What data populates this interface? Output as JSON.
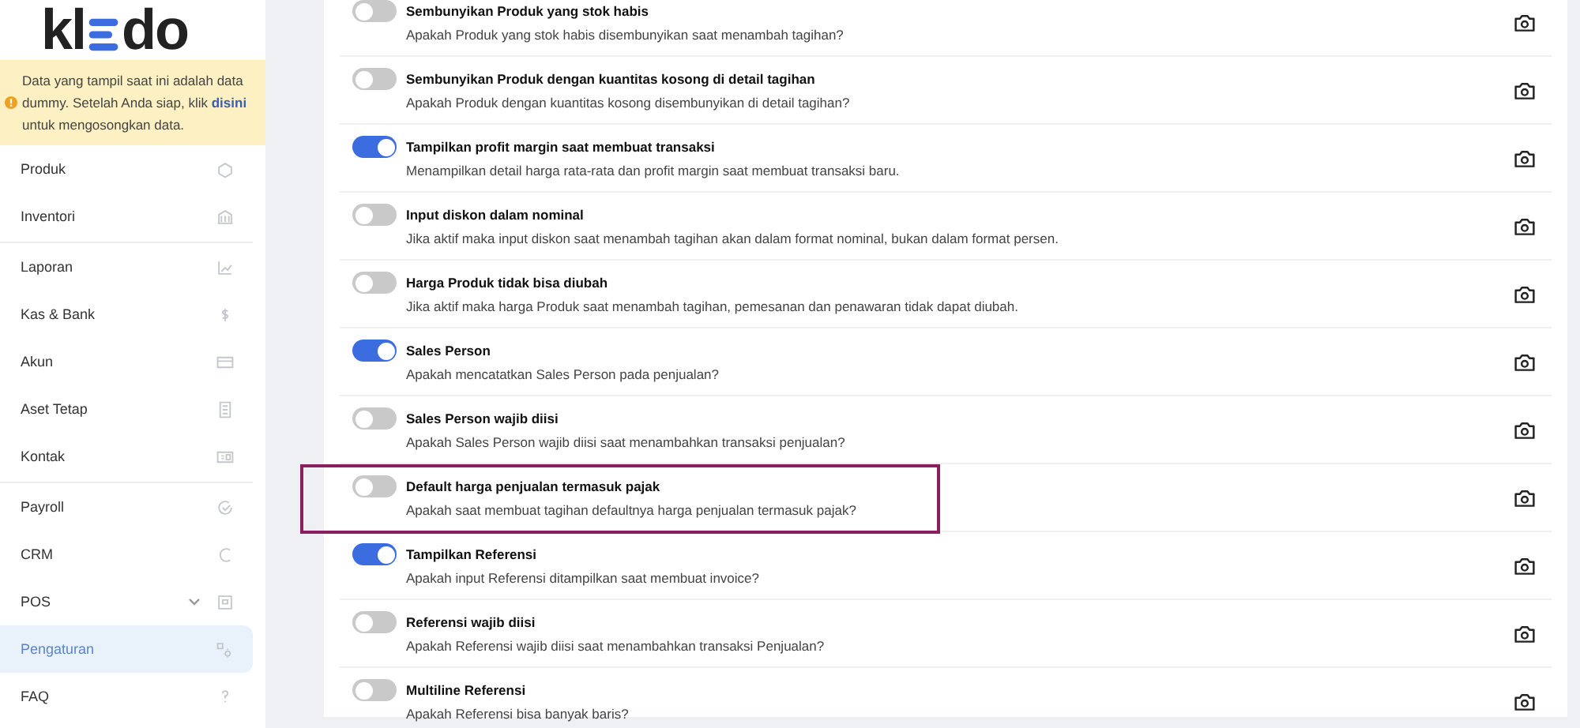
{
  "sidebar": {
    "logo": {
      "left": "kl",
      "right": "do"
    },
    "notice": {
      "before": "Data yang tampil saat ini adalah data dummy. Setelah Anda siap, klik ",
      "link": "disini",
      "after": " untuk mengosongkan data."
    },
    "groups": [
      [
        {
          "label": "Produk",
          "selected": false,
          "expandable": false
        },
        {
          "label": "Inventori",
          "selected": false,
          "expandable": false
        }
      ],
      [
        {
          "label": "Laporan",
          "selected": false,
          "expandable": false
        },
        {
          "label": "Kas & Bank",
          "selected": false,
          "expandable": false
        },
        {
          "label": "Akun",
          "selected": false,
          "expandable": false
        },
        {
          "label": "Aset Tetap",
          "selected": false,
          "expandable": false
        },
        {
          "label": "Kontak",
          "selected": false,
          "expandable": false
        }
      ],
      [
        {
          "label": "Payroll",
          "selected": false,
          "expandable": false
        },
        {
          "label": "CRM",
          "selected": false,
          "expandable": false
        },
        {
          "label": "POS",
          "selected": false,
          "expandable": true
        },
        {
          "label": "Pengaturan",
          "selected": true,
          "expandable": false
        },
        {
          "label": "FAQ",
          "selected": false,
          "expandable": false
        }
      ]
    ]
  },
  "settings": [
    {
      "title": "Sembunyikan Produk yang stok habis",
      "description": "Apakah Produk yang stok habis disembunyikan saat menambah tagihan?",
      "on": false,
      "highlighted": false
    },
    {
      "title": "Sembunyikan Produk dengan kuantitas kosong di detail tagihan",
      "description": "Apakah Produk dengan kuantitas kosong disembunyikan di detail tagihan?",
      "on": false,
      "highlighted": false
    },
    {
      "title": "Tampilkan profit margin saat membuat transaksi",
      "description": "Menampilkan detail harga rata-rata dan profit margin saat membuat transaksi baru.",
      "on": true,
      "highlighted": false
    },
    {
      "title": "Input diskon dalam nominal",
      "description": "Jika aktif maka input diskon saat menambah tagihan akan dalam format nominal, bukan dalam format persen.",
      "on": false,
      "highlighted": false
    },
    {
      "title": "Harga Produk tidak bisa diubah",
      "description": "Jika aktif maka harga Produk saat menambah tagihan, pemesanan dan penawaran tidak dapat diubah.",
      "on": false,
      "highlighted": false
    },
    {
      "title": "Sales Person",
      "description": "Apakah mencatatkan Sales Person pada penjualan?",
      "on": true,
      "highlighted": false
    },
    {
      "title": "Sales Person wajib diisi",
      "description": "Apakah Sales Person wajib diisi saat menambahkan transaksi penjualan?",
      "on": false,
      "highlighted": false
    },
    {
      "title": "Default harga penjualan termasuk pajak",
      "description": "Apakah saat membuat tagihan defaultnya harga penjualan termasuk pajak?",
      "on": false,
      "highlighted": true
    },
    {
      "title": "Tampilkan Referensi",
      "description": "Apakah input Referensi ditampilkan saat membuat invoice?",
      "on": true,
      "highlighted": false
    },
    {
      "title": "Referensi wajib diisi",
      "description": "Apakah Referensi wajib diisi saat menambahkan transaksi Penjualan?",
      "on": false,
      "highlighted": false
    },
    {
      "title": "Multiline Referensi",
      "description": "Apakah Referensi bisa banyak baris?",
      "on": false,
      "highlighted": false
    }
  ]
}
